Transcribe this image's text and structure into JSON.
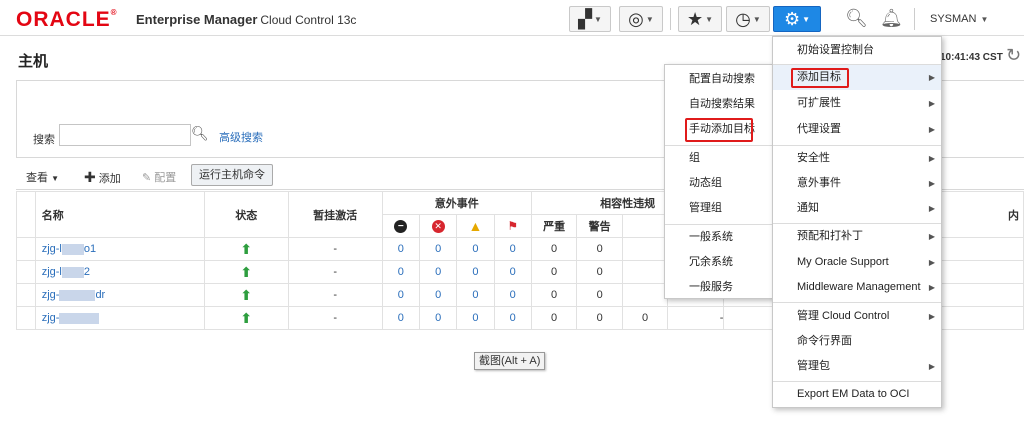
{
  "header": {
    "logo": "ORACLE",
    "product": "Enterprise Manager",
    "product_sub": "Cloud Control 13c",
    "user": "SYSMAN"
  },
  "page": {
    "title": "主机",
    "time": "10:41:43 CST"
  },
  "search": {
    "label": "搜索",
    "placeholder": "",
    "advanced": "高级搜索"
  },
  "toolbar": {
    "view": "查看",
    "add": "添加",
    "configure": "配置",
    "run_command": "运行主机命令"
  },
  "table": {
    "headers": {
      "name": "名称",
      "status": "状态",
      "blackout": "暂挂激活",
      "incidents": "意外事件",
      "compliance": "相容性违规",
      "severe": "严重",
      "warning": "警告",
      "right_cut": "内"
    },
    "rows": [
      {
        "name_prefix": "zjg-l",
        "name_suffix": "o1",
        "blackout": "-",
        "inc": [
          "0",
          "0",
          "0",
          "0"
        ],
        "comp": [
          "0",
          "0"
        ]
      },
      {
        "name_prefix": "zjg-l",
        "name_suffix": "2",
        "blackout": "-",
        "inc": [
          "0",
          "0",
          "0",
          "0"
        ],
        "comp": [
          "0",
          "0"
        ]
      },
      {
        "name_prefix": "zjg-",
        "name_suffix": "dr",
        "blackout": "-",
        "inc": [
          "0",
          "0",
          "0",
          "0"
        ],
        "comp": [
          "0",
          "0"
        ]
      },
      {
        "name_prefix": "zjg-",
        "name_suffix": "",
        "blackout": "-",
        "inc": [
          "0",
          "0",
          "0",
          "0"
        ],
        "comp": [
          "0",
          "0",
          "0",
          "-"
        ]
      }
    ]
  },
  "tooltip": "截图(Alt + A)",
  "setup_menu": {
    "items": [
      "初始设置控制台",
      "添加目标",
      "可扩展性",
      "代理设置",
      "安全性",
      "意外事件",
      "通知",
      "预配和打补丁",
      "My Oracle Support",
      "Middleware Management",
      "管理 Cloud Control",
      "命令行界面",
      "管理包",
      "Export EM Data to OCI"
    ]
  },
  "add_target_menu": {
    "items": [
      "配置自动搜索",
      "自动搜索结果",
      "手动添加目标",
      "组",
      "动态组",
      "管理组",
      "一般系统",
      "冗余系统",
      "一般服务"
    ]
  },
  "colors": {
    "oracle_red": "#e30613",
    "link_blue": "#2a6ebb",
    "active_blue": "#1e88e5",
    "highlight_red": "#e01b1b",
    "status_green": "#2e9e3f"
  }
}
